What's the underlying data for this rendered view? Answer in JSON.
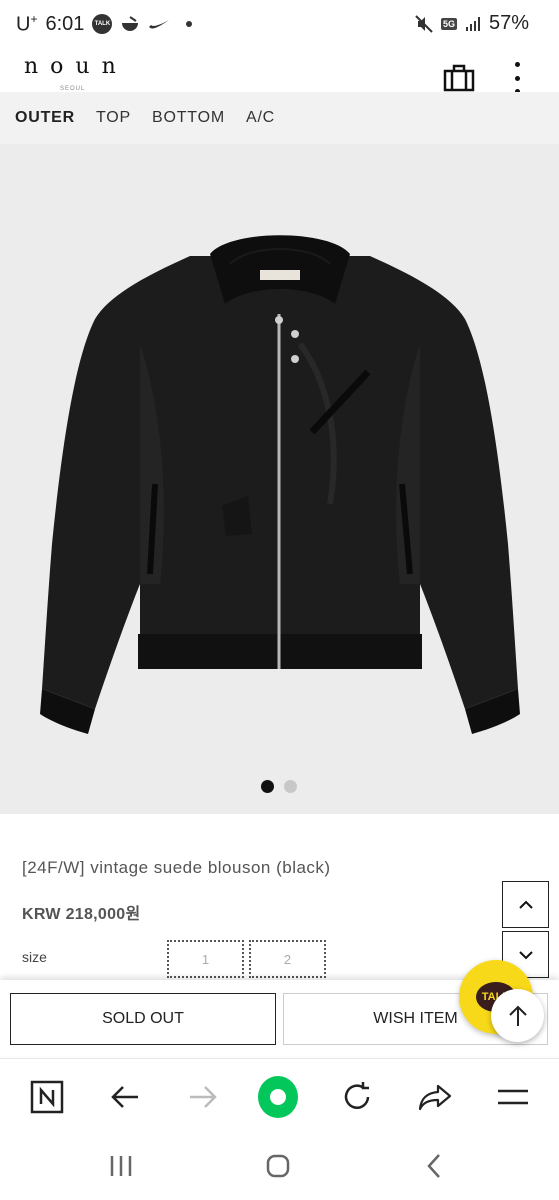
{
  "status_bar": {
    "carrier": "U",
    "carrier_sup": "+",
    "time": "6:01",
    "talk_icon_label": "TALK",
    "network": "5G",
    "battery": "57%"
  },
  "header": {
    "logo": "noun",
    "logo_sub": "SEOUL"
  },
  "categories": [
    {
      "label": "OUTER",
      "active": true
    },
    {
      "label": "TOP",
      "active": false
    },
    {
      "label": "BOTTOM",
      "active": false
    },
    {
      "label": "A/C",
      "active": false
    }
  ],
  "gallery": {
    "current_index": 1,
    "total": 2
  },
  "product": {
    "name": "[24F/W] vintage suede blouson (black)",
    "price": "KRW 218,000원",
    "size_label": "size",
    "sizes": [
      "1",
      "2"
    ]
  },
  "actions": {
    "soldout_label": "SOLD OUT",
    "wish_label": "WISH ITEM"
  },
  "kakao": {
    "label": "TALK"
  },
  "icons": {
    "bag": "shopping-bag-icon",
    "more": "more-vertical-icon",
    "scroll_up": "chevron-up-icon",
    "scroll_down": "chevron-down-icon",
    "scroll_top": "arrow-up-icon",
    "browser_home": "naver-n-icon",
    "browser_back": "arrow-left-icon",
    "browser_forward": "arrow-right-icon",
    "browser_green": "green-dot-icon",
    "browser_reload": "reload-icon",
    "browser_share": "share-icon",
    "browser_menu": "hamburger-icon",
    "sys_recent": "recent-apps-icon",
    "sys_home": "home-icon",
    "sys_back": "back-icon"
  },
  "colors": {
    "accent_green": "#03c75a",
    "kakao_yellow": "#f7d91a",
    "nav_bg": "#f2f2f2",
    "image_bg": "#ececec"
  }
}
